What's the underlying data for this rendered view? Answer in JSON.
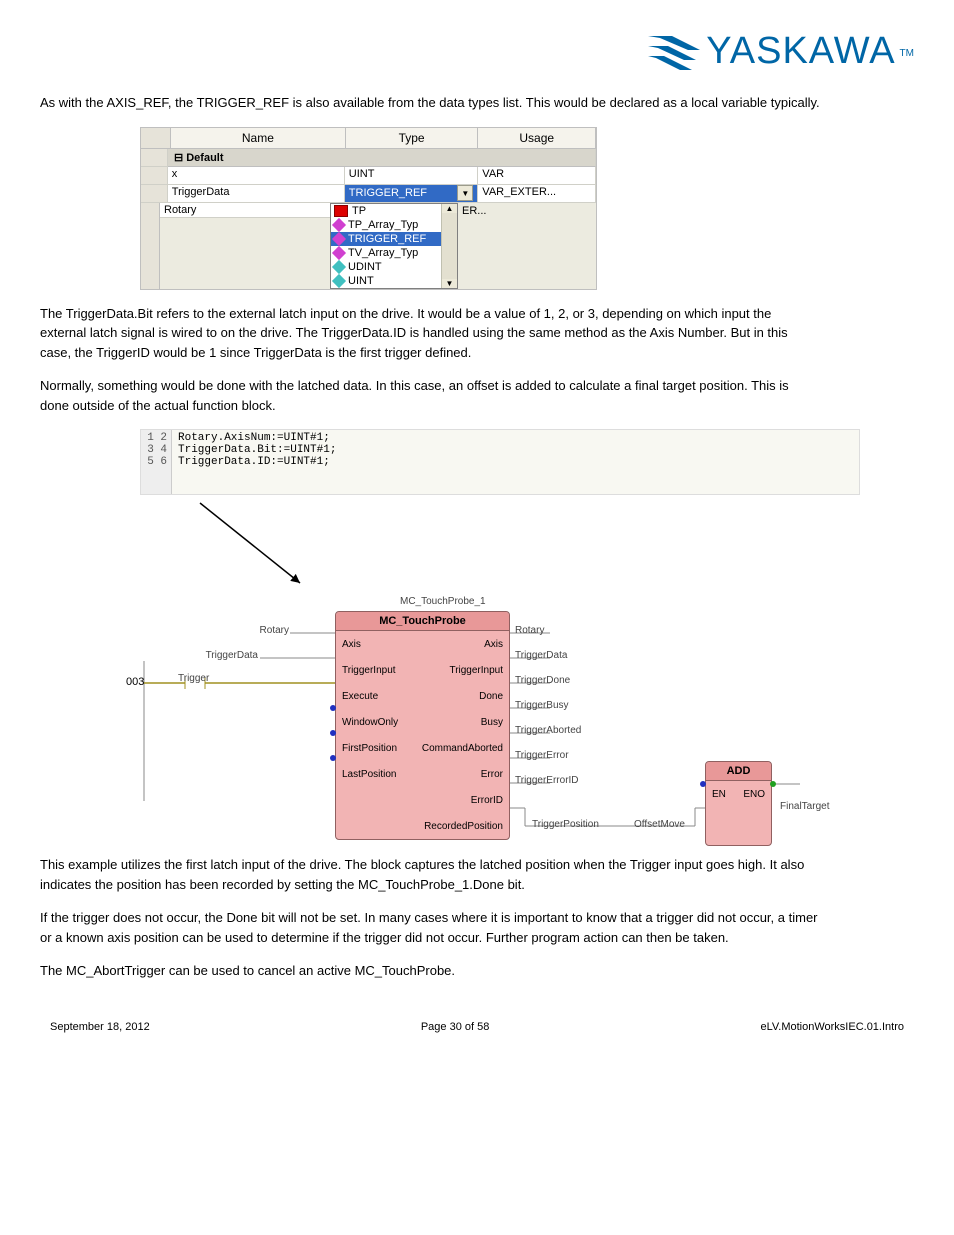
{
  "logo": {
    "text": "YASKAWA",
    "tm": "TM"
  },
  "paragraphs": {
    "p1": "As with the AXIS_REF, the TRIGGER_REF is also available from the data types list. This would be declared as a local variable typically.",
    "p2": "The TriggerData.Bit refers to the external latch input on the drive. It would be a value of 1, 2, or 3, depending on which input the external latch signal is wired to on the drive. The TriggerData.ID is handled using the same method as the Axis Number. But in this case, the TriggerID would be 1 since TriggerData is the first trigger defined.",
    "p3": "Normally, something would be done with the latched data. In this case, an offset is added to calculate a final target position. This is done outside of the actual function block.",
    "p4": "This example utilizes the first latch input of the drive. The block captures the latched position when the Trigger input goes high. It also indicates the position has been recorded by setting the MC_TouchProbe_1.Done bit.",
    "p5": "If the trigger does not occur, the Done bit will not be set. In many cases where it is important to know that a trigger did not occur, a timer or a known axis position can be used to determine if the trigger did not occur. Further program action can then be taken.",
    "p6": "The MC_AbortTrigger can be used to cancel an active MC_TouchProbe."
  },
  "grid": {
    "head": {
      "name": "Name",
      "type": "Type",
      "usage": "Usage"
    },
    "default_label": "Default",
    "rows": [
      {
        "name": "x",
        "type": "UINT",
        "usage": "VAR"
      },
      {
        "name": "TriggerData",
        "type": "TRIGGER_REF",
        "usage": "VAR_EXTER..."
      },
      {
        "name": "Rotary",
        "type_is_dropdown": true,
        "right_overflow": "ER..."
      }
    ],
    "dropdown": [
      {
        "icon": "fb",
        "label": "TP"
      },
      {
        "icon": "dt",
        "label": "TP_Array_Typ"
      },
      {
        "icon": "dt",
        "label": "TRIGGER_REF",
        "selected": true
      },
      {
        "icon": "dt",
        "label": "TV_Array_Typ"
      },
      {
        "icon": "pt",
        "label": "UDINT"
      },
      {
        "icon": "pt",
        "label": "UINT"
      }
    ]
  },
  "code": {
    "gutter": "1\n2\n3\n4\n5\n6",
    "lines": "Rotary.AxisNum:=UINT#1;\nTriggerData.Bit:=UINT#1;\nTriggerData.ID:=UINT#1;\n\n\n"
  },
  "fb": {
    "instance": "MC_TouchProbe_1",
    "type": "MC_TouchProbe",
    "left_ports": [
      "Axis",
      "TriggerInput",
      "Execute",
      "WindowOnly",
      "FirstPosition",
      "LastPosition"
    ],
    "right_ports": [
      "Axis",
      "TriggerInput",
      "Done",
      "Busy",
      "CommandAborted",
      "Error",
      "ErrorID",
      "RecordedPosition"
    ],
    "left_labels": {
      "axis": "Rotary",
      "trigger": "TriggerData",
      "exec_switch": "Trigger"
    },
    "right_labels": [
      "Rotary",
      "TriggerData",
      "TriggerDone",
      "TriggerBusy",
      "TriggerAborted",
      "TriggerError",
      "TriggerErrorID",
      "TriggerPosition"
    ]
  },
  "add": {
    "title": "ADD",
    "left": "EN",
    "rightp": "ENO",
    "in2": "OffsetMove",
    "out": "FinalTarget"
  },
  "rung_number": "003",
  "footer": {
    "left": "September 18, 2012",
    "center": "Page 30 of 58",
    "right": "eLV.MotionWorksIEC.01.Intro"
  }
}
